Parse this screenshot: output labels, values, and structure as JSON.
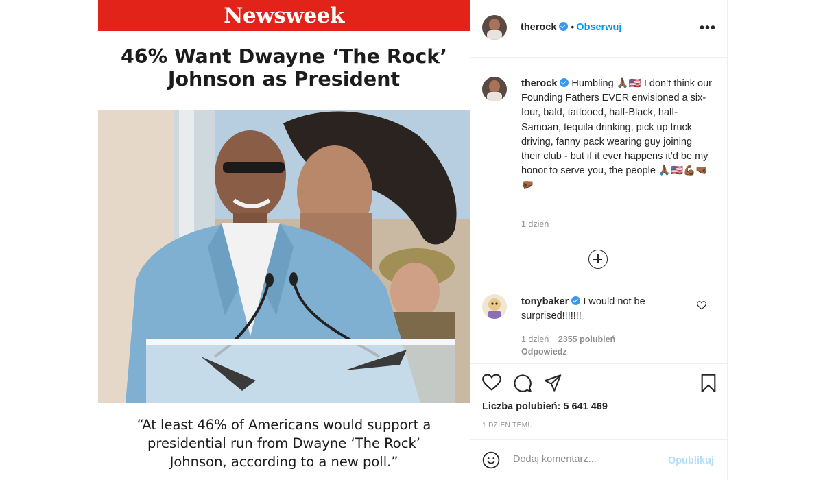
{
  "post": {
    "brand": "Newsweek",
    "headline_line1": "46% Want Dwayne ‘The Rock’",
    "headline_line2": "Johnson as President",
    "quote_line1": "“At least 46% of Americans would support a",
    "quote_line2": "presidential run from Dwayne ‘The Rock’",
    "quote_line3": "Johnson, according to a new poll.”"
  },
  "header": {
    "username": "therock",
    "separator": "•",
    "follow_label": "Obserwuj",
    "more_label": "•••"
  },
  "caption": {
    "username": "therock",
    "text": "Humbling 🙏🏾🇺🇸 I don’t think our Founding Fathers EVER envisioned a six-four, bald, tattooed, half-Black, half-Samoan, tequila drinking, pick up truck driving, fanny pack wearing guy joining their club - but if it ever happens it’d be my honor to serve you, the people 🙏🏾🇺🇸💪🏾🤜🏾 🤛🏾",
    "time": "1 dzień"
  },
  "comment": {
    "username": "tonybaker",
    "text": "I would not be surprised!!!!!!!",
    "time": "1 dzień",
    "likes": "2355 polubień",
    "reply_label": "Odpowiedz"
  },
  "actions": {
    "likes_label": "Liczba polubień:",
    "likes_count": "5 641 469",
    "post_time": "1 DZIEŃ TEMU"
  },
  "add_comment": {
    "placeholder": "Dodaj komentarz...",
    "publish_label": "Opublikuj"
  },
  "colors": {
    "newsweek_red": "#e2231a",
    "link_blue": "#0095f6",
    "verified_blue": "#3897f0",
    "muted_gray": "#8e8e8e",
    "publish_disabled": "#b2dffc"
  },
  "icons": [
    "verified-badge-icon",
    "more-options-icon",
    "add-comment-plus-icon",
    "heart-icon",
    "comment-icon",
    "share-icon",
    "bookmark-icon",
    "emoji-icon"
  ]
}
